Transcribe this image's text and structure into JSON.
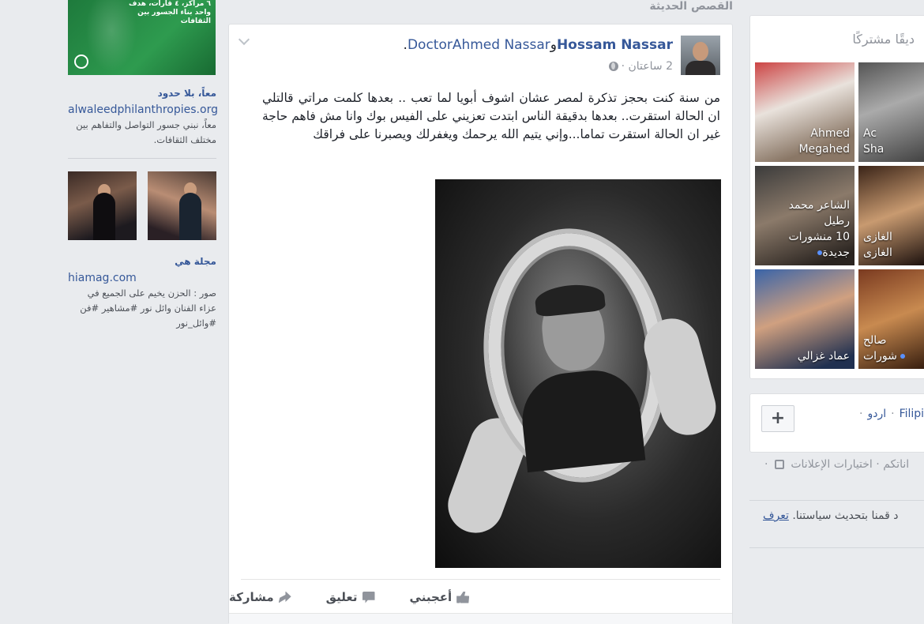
{
  "left_ads": {
    "banner": {
      "text": "٦ مراكز، ٤ قارات، هدف واحد بناء الجسور بين الثقافات"
    },
    "ad1": {
      "title": "معاً، بلا حدود",
      "url": "alwaleedphilanthropies.org",
      "description": "معاً، نبني جسور التواصل والتفاهم بين مختلف الثقافات."
    },
    "ad2": {
      "title": "مجلة هي",
      "url": "hiamag.com",
      "description": "صور : الحزن يخيم على الجميع في عزاء الفنان وائل نور #مشاهير #فن #وائل_نور"
    }
  },
  "feed": {
    "section_title": "القصص الحديثة"
  },
  "post": {
    "author": "Hossam Nassar",
    "conjunction": "و",
    "tagged": "DoctorAhmed Nassar",
    "tagged_suffix": ".",
    "time": "2 ساعتان ·",
    "privacy_icon": "globe-icon",
    "text": "من سنة كنت بحجز تذكرة لمصر عشان اشوف أبويا لما تعب .. بعدها كلمت مراتي قالتلي ان الحالة استقرت.. بعدها بدقيقة الناس ابتدت تعزيني على الفيس بوك وانا مش فاهم حاجة غير ان الحالة استقرت تماما...وإني يتيم الله يرحمك ويغفرلك ويصبرنا على فراقك",
    "actions": {
      "like": "أعجبني",
      "comment": "تعليق",
      "share": "مشاركة"
    }
  },
  "right": {
    "title": "أصدقاء بينكم أصدقاء مشتركًا",
    "title_visible": "ديقًا مشتركًا",
    "tiles": [
      {
        "lines": [
          "Ahmed",
          "Megahed"
        ],
        "dot": false
      },
      {
        "lines": [
          "Ac",
          "Sha"
        ],
        "dot": false
      },
      {
        "lines": [
          "الشاعر محمد",
          "رطيل",
          "10 منشورات",
          "جديدة"
        ],
        "dot": true
      },
      {
        "lines": [
          "الغازى",
          "الغازى"
        ],
        "dot": false
      },
      {
        "lines": [
          "عماد غزالي"
        ],
        "dot": false
      },
      {
        "lines": [
          "صالح",
          "شورات"
        ],
        "dot": true
      }
    ],
    "languages": {
      "lang1": "Filipino",
      "lang2": "اردو"
    },
    "footer": {
      "ad_choices": "اختيارات الإعلانات",
      "privacy_partial": "اناتكم"
    },
    "policy": {
      "text": "د قمنا بتحديث سياستنا.",
      "link": "تعرف"
    }
  }
}
